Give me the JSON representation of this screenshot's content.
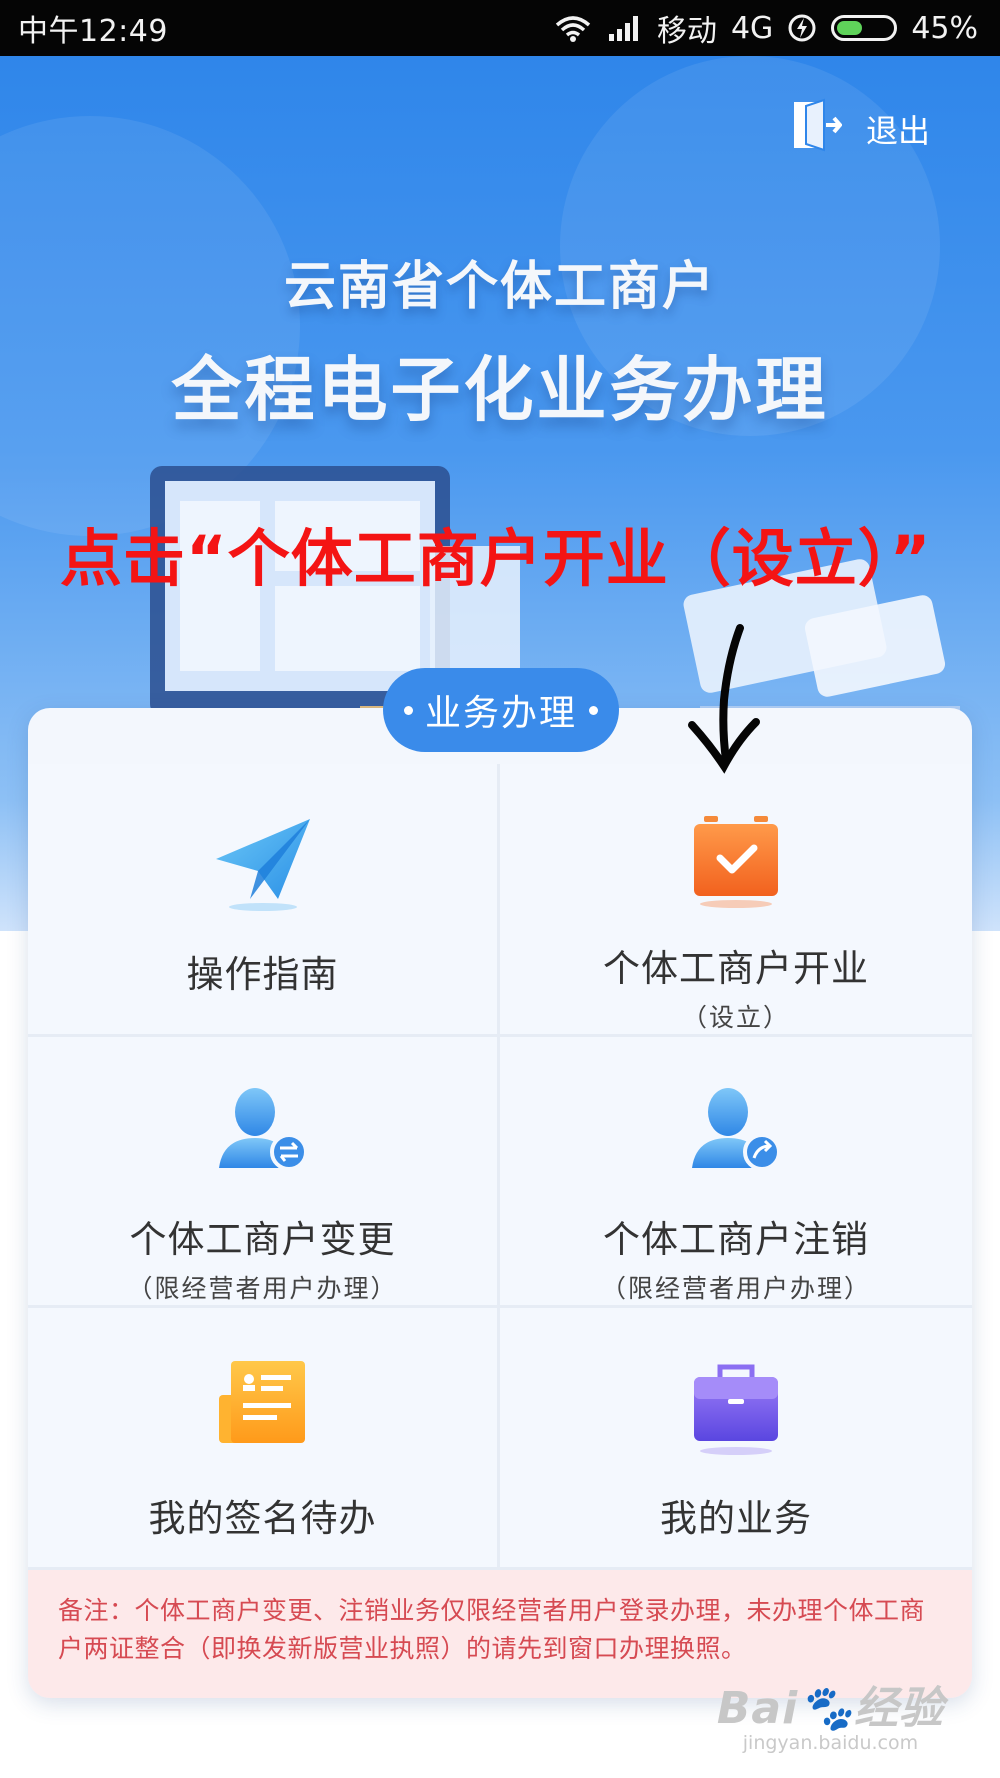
{
  "status_bar": {
    "time": "中午12:49",
    "carrier": "移动",
    "network": "4G",
    "battery": "45%",
    "battery_level": 0.45
  },
  "header": {
    "exit_label": "退出",
    "title_line1": "云南省个体工商户",
    "title_line2": "全程电子化业务办理"
  },
  "annotation": {
    "text": "点击“个体工商户开业（设立）”"
  },
  "card": {
    "section_label": "业务办理",
    "items": [
      {
        "label": "操作指南",
        "sub": "",
        "icon": "paper-plane-icon"
      },
      {
        "label": "个体工商户开业",
        "sub": "（设立）",
        "icon": "calendar-check-icon"
      },
      {
        "label": "个体工商户变更",
        "sub": "（限经营者用户办理）",
        "icon": "user-change-icon"
      },
      {
        "label": "个体工商户注销",
        "sub": "（限经营者用户办理）",
        "icon": "user-cancel-icon"
      },
      {
        "label": "我的签名待办",
        "sub": "",
        "icon": "document-icon"
      },
      {
        "label": "我的业务",
        "sub": "",
        "icon": "briefcase-icon"
      }
    ],
    "notice": "备注：个体工商户变更、注销业务仅限经营者用户登录办理，未办理个体工商户两证整合（即换发新版营业执照）的请先到窗口办理换照。"
  },
  "colors": {
    "banner_top": "#2f86ea",
    "accent_blue": "#3a8bea",
    "annotation_red": "#f41414",
    "notice_bg": "#fde9ea",
    "notice_text": "#d64a52"
  }
}
